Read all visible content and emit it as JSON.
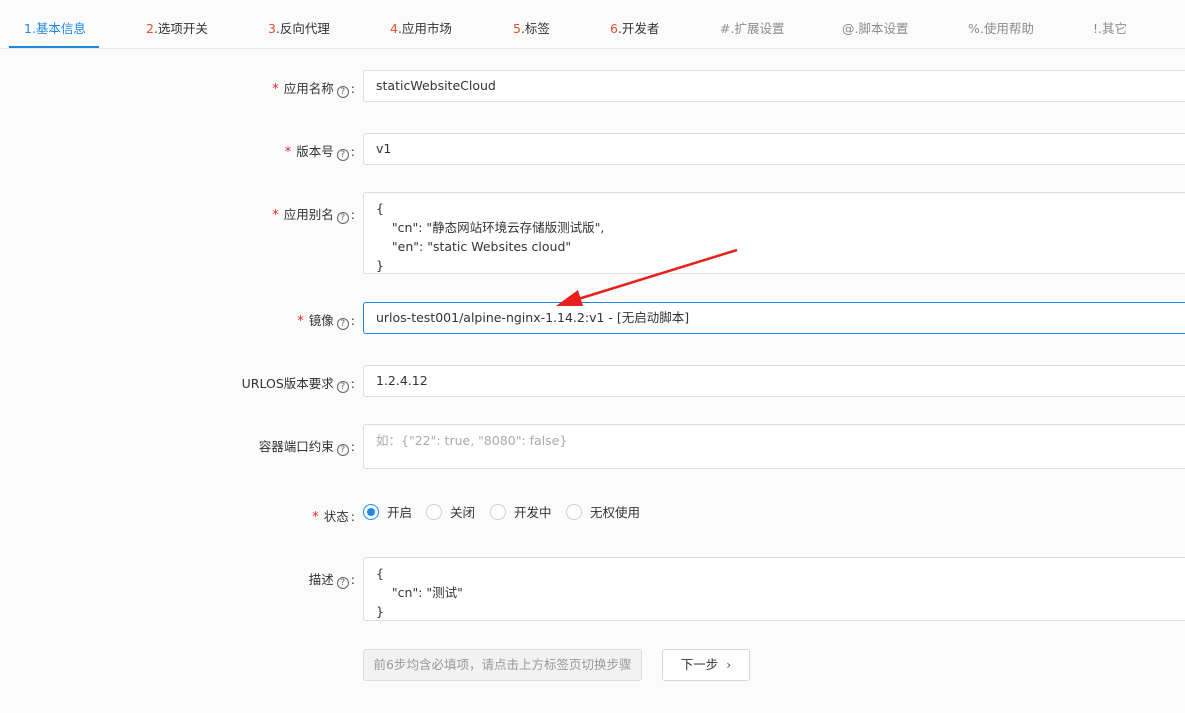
{
  "tabs": [
    {
      "num": "1",
      "label": ".基本信息"
    },
    {
      "num": "2",
      "label": ".选项开关"
    },
    {
      "num": "3",
      "label": ".反向代理"
    },
    {
      "num": "4",
      "label": ".应用市场"
    },
    {
      "num": "5",
      "label": ".标签"
    },
    {
      "num": "6",
      "label": ".开发者"
    },
    {
      "num": "#",
      "label": ".扩展设置"
    },
    {
      "num": "@",
      "label": ".脚本设置"
    },
    {
      "num": "%",
      "label": ".使用帮助"
    },
    {
      "num": "!",
      "label": ".其它"
    }
  ],
  "form": {
    "app_name": {
      "label": "应用名称",
      "value": "staticWebsiteCloud"
    },
    "version": {
      "label": "版本号",
      "value": "v1"
    },
    "alias": {
      "label": "应用别名",
      "value": "{\n    \"cn\": \"静态网站环境云存储版测试版\",\n    \"en\": \"static Websites cloud\"\n}"
    },
    "image": {
      "label": "镜像",
      "value": "urlos-test001/alpine-nginx-1.14.2:v1 - [无启动脚本]"
    },
    "urlos_version": {
      "label": "URLOS版本要求",
      "value": "1.2.4.12"
    },
    "port_constraint": {
      "label": "容器端口约束",
      "placeholder": "如：{\"22\": true, \"8080\": false}"
    },
    "status": {
      "label": "状态",
      "options": [
        "开启",
        "关闭",
        "开发中",
        "无权使用"
      ],
      "selected": "开启"
    },
    "description": {
      "label": "描述",
      "value": "{\n    \"cn\": \"测试\"\n}"
    }
  },
  "buttons": {
    "hint": "前6步均含必填项，请点击上方标签页切换步骤",
    "next": "下一步"
  },
  "colors": {
    "accent": "#1e88e5",
    "tab_number": "#e0532a",
    "required": "#e0282c",
    "annotation_arrow": "#e8201c"
  },
  "icons": {
    "help": "question-circle-icon",
    "next": "chevron-right-icon"
  }
}
